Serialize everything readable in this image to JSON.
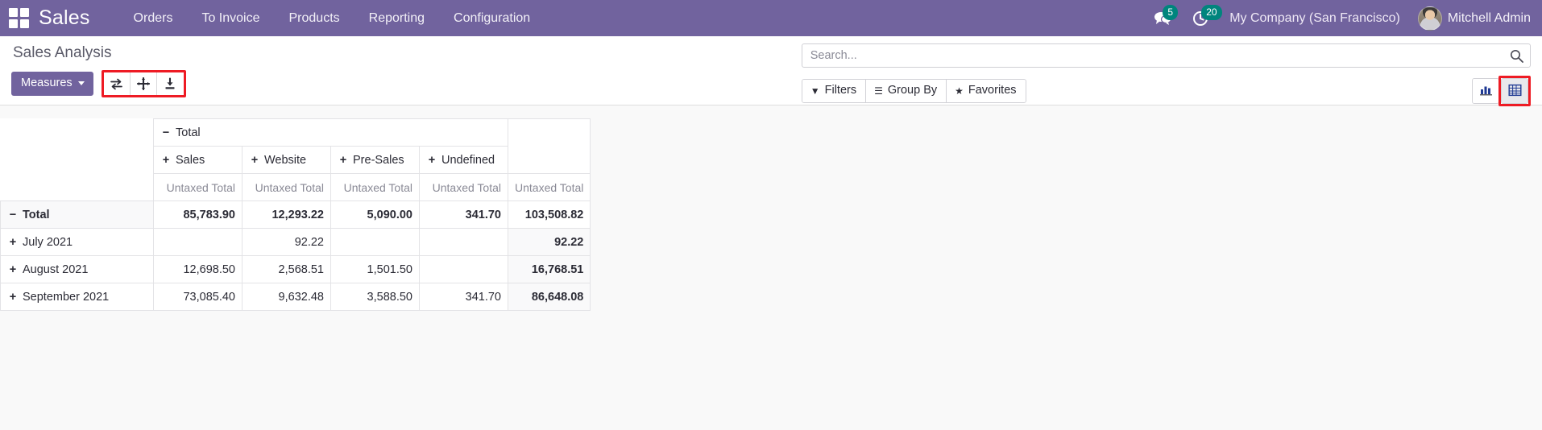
{
  "navbar": {
    "apps_icon": "apps-grid-icon",
    "brand": "Sales",
    "menu": [
      {
        "label": "Orders"
      },
      {
        "label": "To Invoice"
      },
      {
        "label": "Products"
      },
      {
        "label": "Reporting"
      },
      {
        "label": "Configuration"
      }
    ],
    "messages_badge": "5",
    "activities_badge": "20",
    "company": "My Company (San Francisco)",
    "user": "Mitchell Admin"
  },
  "control_panel": {
    "title": "Sales Analysis",
    "measures_label": "Measures",
    "icon_buttons": [
      {
        "name": "flip-axis-icon",
        "title": "Flip axis"
      },
      {
        "name": "expand-all-icon",
        "title": "Expand all"
      },
      {
        "name": "download-xlsx-icon",
        "title": "Download xlsx"
      }
    ],
    "search": {
      "placeholder": "Search...",
      "value": ""
    },
    "filters": [
      {
        "label": "Filters",
        "icon": "filter-icon"
      },
      {
        "label": "Group By",
        "icon": "list-icon"
      },
      {
        "label": "Favorites",
        "icon": "star-icon"
      }
    ],
    "views": [
      {
        "name": "graph-view",
        "icon": "bar-chart-icon",
        "active": false
      },
      {
        "name": "pivot-view",
        "icon": "pivot-table-icon",
        "active": true
      }
    ],
    "highlight_color": "#ee1b24",
    "accent_color": "#71639e"
  },
  "chart_data": {
    "type": "table",
    "title": "Sales Analysis",
    "measure": "Untaxed Total",
    "col_group_label": "Total",
    "col_group_toggle": "−",
    "row_group_label": "Total",
    "row_group_toggle": "−",
    "child_toggle": "+",
    "categories": [
      "Sales",
      "Website",
      "Pre-Sales",
      "Undefined"
    ],
    "measure_headers": [
      "Untaxed Total",
      "Untaxed Total",
      "Untaxed Total",
      "Untaxed Total",
      "Untaxed Total"
    ],
    "total_row": {
      "label": "Total",
      "values": [
        "85,783.90",
        "12,293.22",
        "5,090.00",
        "341.70"
      ],
      "total": "103,508.82"
    },
    "rows": [
      {
        "label": "July 2021",
        "values": [
          "",
          "92.22",
          "",
          ""
        ],
        "total": "92.22"
      },
      {
        "label": "August 2021",
        "values": [
          "12,698.50",
          "2,568.51",
          "1,501.50",
          ""
        ],
        "total": "16,768.51"
      },
      {
        "label": "September 2021",
        "values": [
          "73,085.40",
          "9,632.48",
          "3,588.50",
          "341.70"
        ],
        "total": "86,648.08"
      }
    ]
  }
}
